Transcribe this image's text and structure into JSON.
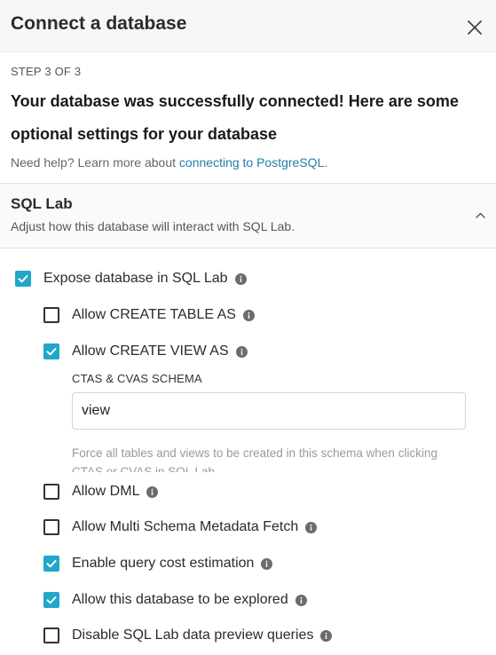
{
  "modal": {
    "title": "Connect a database",
    "close_icon": "close-icon"
  },
  "step": {
    "label": "STEP 3 OF 3",
    "success_message": "Your database was successfully connected! Here are some optional settings for your database",
    "help_prefix": "Need help? Learn more about ",
    "help_link": "connecting to PostgreSQL."
  },
  "panel": {
    "title": "SQL Lab",
    "subtitle": "Adjust how this database will interact with SQL Lab.",
    "chevron_icon": "chevron-up-icon"
  },
  "options": [
    {
      "label": "Expose database in SQL Lab",
      "checked": true
    },
    {
      "label": "Allow CREATE TABLE AS",
      "checked": false
    },
    {
      "label": "Allow CREATE VIEW AS",
      "checked": true
    },
    {
      "label": "Allow DML",
      "checked": false
    },
    {
      "label": "Allow Multi Schema Metadata Fetch",
      "checked": false
    },
    {
      "label": "Enable query cost estimation",
      "checked": true
    },
    {
      "label": "Allow this database to be explored",
      "checked": true
    },
    {
      "label": "Disable SQL Lab data preview queries",
      "checked": false
    }
  ],
  "schema_field": {
    "label": "CTAS & CVAS SCHEMA",
    "value": "view",
    "help": "Force all tables and views to be created in this schema when clicking CTAS or CVAS in SQL Lab."
  },
  "colors": {
    "accent": "#20a7c9",
    "link": "#1f7fa6"
  }
}
